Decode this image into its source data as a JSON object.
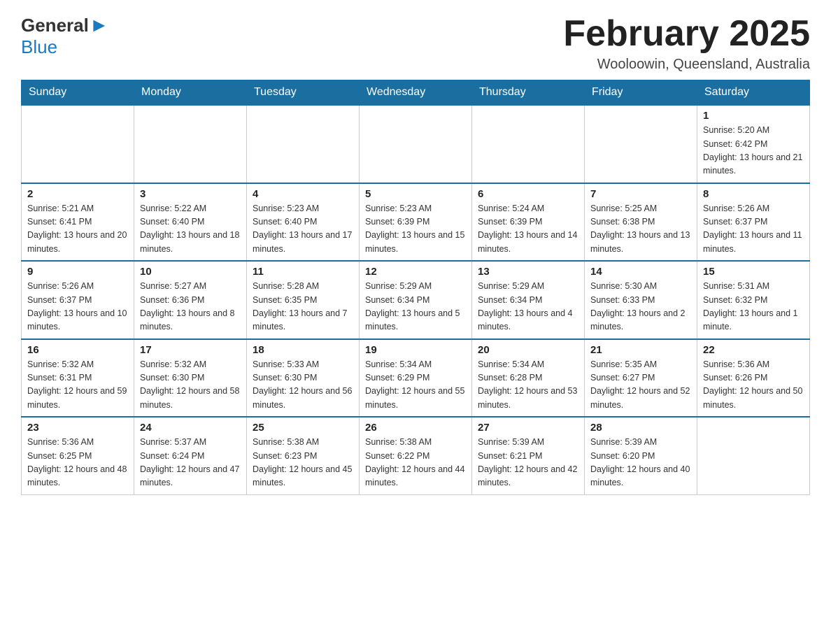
{
  "header": {
    "logo": {
      "general": "General",
      "blue": "Blue"
    },
    "title": "February 2025",
    "location": "Wooloowin, Queensland, Australia"
  },
  "weekdays": [
    "Sunday",
    "Monday",
    "Tuesday",
    "Wednesday",
    "Thursday",
    "Friday",
    "Saturday"
  ],
  "weeks": [
    [
      {
        "day": "",
        "info": ""
      },
      {
        "day": "",
        "info": ""
      },
      {
        "day": "",
        "info": ""
      },
      {
        "day": "",
        "info": ""
      },
      {
        "day": "",
        "info": ""
      },
      {
        "day": "",
        "info": ""
      },
      {
        "day": "1",
        "info": "Sunrise: 5:20 AM\nSunset: 6:42 PM\nDaylight: 13 hours and 21 minutes."
      }
    ],
    [
      {
        "day": "2",
        "info": "Sunrise: 5:21 AM\nSunset: 6:41 PM\nDaylight: 13 hours and 20 minutes."
      },
      {
        "day": "3",
        "info": "Sunrise: 5:22 AM\nSunset: 6:40 PM\nDaylight: 13 hours and 18 minutes."
      },
      {
        "day": "4",
        "info": "Sunrise: 5:23 AM\nSunset: 6:40 PM\nDaylight: 13 hours and 17 minutes."
      },
      {
        "day": "5",
        "info": "Sunrise: 5:23 AM\nSunset: 6:39 PM\nDaylight: 13 hours and 15 minutes."
      },
      {
        "day": "6",
        "info": "Sunrise: 5:24 AM\nSunset: 6:39 PM\nDaylight: 13 hours and 14 minutes."
      },
      {
        "day": "7",
        "info": "Sunrise: 5:25 AM\nSunset: 6:38 PM\nDaylight: 13 hours and 13 minutes."
      },
      {
        "day": "8",
        "info": "Sunrise: 5:26 AM\nSunset: 6:37 PM\nDaylight: 13 hours and 11 minutes."
      }
    ],
    [
      {
        "day": "9",
        "info": "Sunrise: 5:26 AM\nSunset: 6:37 PM\nDaylight: 13 hours and 10 minutes."
      },
      {
        "day": "10",
        "info": "Sunrise: 5:27 AM\nSunset: 6:36 PM\nDaylight: 13 hours and 8 minutes."
      },
      {
        "day": "11",
        "info": "Sunrise: 5:28 AM\nSunset: 6:35 PM\nDaylight: 13 hours and 7 minutes."
      },
      {
        "day": "12",
        "info": "Sunrise: 5:29 AM\nSunset: 6:34 PM\nDaylight: 13 hours and 5 minutes."
      },
      {
        "day": "13",
        "info": "Sunrise: 5:29 AM\nSunset: 6:34 PM\nDaylight: 13 hours and 4 minutes."
      },
      {
        "day": "14",
        "info": "Sunrise: 5:30 AM\nSunset: 6:33 PM\nDaylight: 13 hours and 2 minutes."
      },
      {
        "day": "15",
        "info": "Sunrise: 5:31 AM\nSunset: 6:32 PM\nDaylight: 13 hours and 1 minute."
      }
    ],
    [
      {
        "day": "16",
        "info": "Sunrise: 5:32 AM\nSunset: 6:31 PM\nDaylight: 12 hours and 59 minutes."
      },
      {
        "day": "17",
        "info": "Sunrise: 5:32 AM\nSunset: 6:30 PM\nDaylight: 12 hours and 58 minutes."
      },
      {
        "day": "18",
        "info": "Sunrise: 5:33 AM\nSunset: 6:30 PM\nDaylight: 12 hours and 56 minutes."
      },
      {
        "day": "19",
        "info": "Sunrise: 5:34 AM\nSunset: 6:29 PM\nDaylight: 12 hours and 55 minutes."
      },
      {
        "day": "20",
        "info": "Sunrise: 5:34 AM\nSunset: 6:28 PM\nDaylight: 12 hours and 53 minutes."
      },
      {
        "day": "21",
        "info": "Sunrise: 5:35 AM\nSunset: 6:27 PM\nDaylight: 12 hours and 52 minutes."
      },
      {
        "day": "22",
        "info": "Sunrise: 5:36 AM\nSunset: 6:26 PM\nDaylight: 12 hours and 50 minutes."
      }
    ],
    [
      {
        "day": "23",
        "info": "Sunrise: 5:36 AM\nSunset: 6:25 PM\nDaylight: 12 hours and 48 minutes."
      },
      {
        "day": "24",
        "info": "Sunrise: 5:37 AM\nSunset: 6:24 PM\nDaylight: 12 hours and 47 minutes."
      },
      {
        "day": "25",
        "info": "Sunrise: 5:38 AM\nSunset: 6:23 PM\nDaylight: 12 hours and 45 minutes."
      },
      {
        "day": "26",
        "info": "Sunrise: 5:38 AM\nSunset: 6:22 PM\nDaylight: 12 hours and 44 minutes."
      },
      {
        "day": "27",
        "info": "Sunrise: 5:39 AM\nSunset: 6:21 PM\nDaylight: 12 hours and 42 minutes."
      },
      {
        "day": "28",
        "info": "Sunrise: 5:39 AM\nSunset: 6:20 PM\nDaylight: 12 hours and 40 minutes."
      },
      {
        "day": "",
        "info": ""
      }
    ]
  ]
}
